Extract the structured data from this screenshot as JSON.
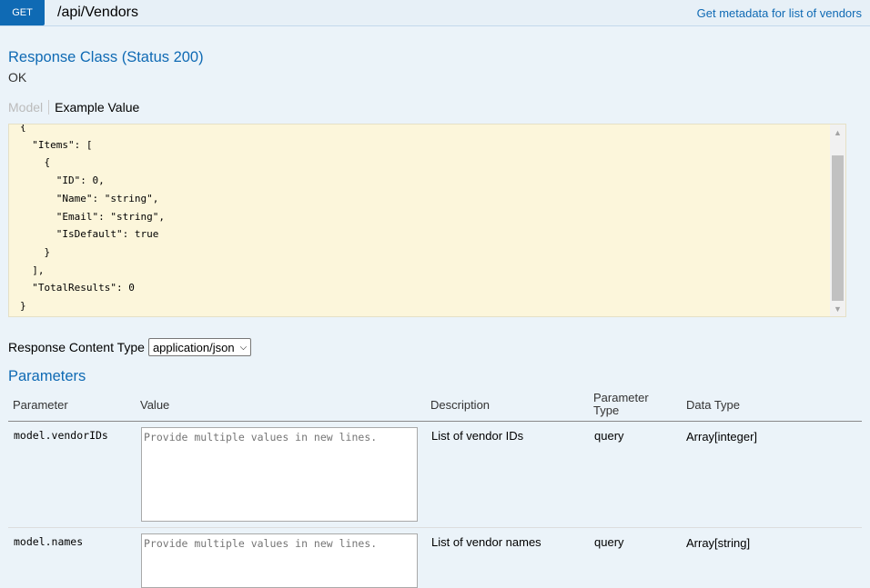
{
  "header": {
    "method": "GET",
    "path": "/api/Vendors",
    "summary": "Get metadata for list of vendors"
  },
  "response": {
    "class_title": "Response Class (Status 200)",
    "status_text": "OK",
    "tabs": {
      "model": "Model",
      "example": "Example Value"
    },
    "example_lines": [
      "{",
      "  \"Items\": [",
      "    {",
      "      \"ID\": 0,",
      "      \"Name\": \"string\",",
      "      \"Email\": \"string\",",
      "      \"IsDefault\": true",
      "    }",
      "  ],",
      "  \"TotalResults\": 0",
      "}"
    ],
    "content_type_label": "Response Content Type",
    "content_type_value": "application/json"
  },
  "parameters": {
    "title": "Parameters",
    "headers": {
      "parameter": "Parameter",
      "value": "Value",
      "description": "Description",
      "parameter_type_line1": "Parameter",
      "parameter_type_line2": "Type",
      "data_type": "Data Type"
    },
    "rows": [
      {
        "name": "model.vendorIDs",
        "placeholder": "Provide multiple values in new lines.",
        "description": "List of vendor IDs",
        "type": "query",
        "data_type": "Array[integer]"
      },
      {
        "name": "model.names",
        "placeholder": "Provide multiple values in new lines.",
        "description": "List of vendor names",
        "type": "query",
        "data_type": "Array[string]"
      }
    ]
  },
  "colors": {
    "accent": "#0f6ab4",
    "background": "#ebf3f9",
    "code_background": "#fcf6db"
  }
}
